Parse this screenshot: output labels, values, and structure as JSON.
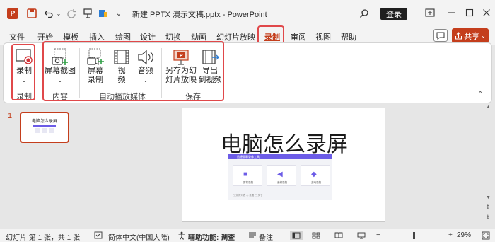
{
  "titlebar": {
    "app_icon": "powerpoint-logo-icon",
    "title": "新建 PPTX 演示文稿.pptx  -  PowerPoint",
    "login": "登录",
    "icons": [
      "save-icon",
      "undo-icon",
      "redo-icon",
      "pin-icon",
      "presenter-icon",
      "customize-icon",
      "search-icon"
    ]
  },
  "tabs": [
    "文件",
    "开始",
    "模板",
    "插入",
    "绘图",
    "设计",
    "切换",
    "动画",
    "幻灯片放映",
    "录制",
    "审阅",
    "视图",
    "帮助"
  ],
  "active_tab": "录制",
  "share": {
    "label": "共享"
  },
  "ribbon": {
    "record": {
      "label": "录制",
      "group": "录制"
    },
    "content": {
      "screenshot": "屏幕截图",
      "group": "内容"
    },
    "media": {
      "screen_record_1": "屏幕",
      "screen_record_2": "录制",
      "video_1": "视",
      "video_2": "频",
      "audio_1": "音频",
      "group": "自动播放媒体"
    },
    "save": {
      "save_as_show_1": "另存为幻",
      "save_as_show_2": "灯片放映",
      "export_1": "导出",
      "export_2": "到视频",
      "group": "保存"
    }
  },
  "thumbnail": {
    "number": "1",
    "title": "电脑怎么录屏"
  },
  "slide": {
    "title": "电脑怎么录屏",
    "screenshot": {
      "header": "迅捷屏幕录像工具",
      "cards": [
        "屏幕录制",
        "音频录制",
        "游戏录制"
      ],
      "footer": "▢ 文件列表  ◎ 设置  ▢ 关于"
    }
  },
  "status": {
    "slide_info": "幻灯片 第 1 张，共 1 张",
    "language": "简体中文(中国大陆)",
    "accessibility": "辅助功能: 调查",
    "notes": "备注",
    "zoom": "29%"
  },
  "colors": {
    "accent": "#c43e1c",
    "highlight": "#e0484a",
    "app_purple": "#6c5ce7"
  }
}
